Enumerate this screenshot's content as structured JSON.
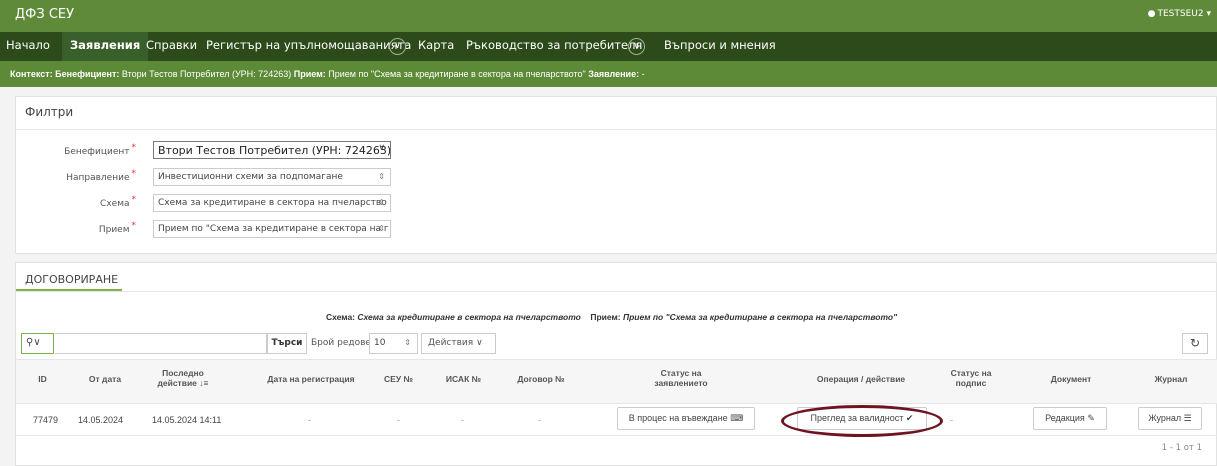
{
  "app": {
    "title": "ДФЗ СЕУ",
    "user": "TESTSEU2"
  },
  "nav": {
    "items": [
      "Начало",
      "Заявления",
      "Справки",
      "Регистър на упълномощаванията",
      "Карта",
      "Ръководство за потребителя",
      "Въпроси и мнения"
    ]
  },
  "context": {
    "l1": "Контекст:",
    "l2": "Бенефициент:",
    "v2": "Втори Тестов Потребител (УРН: 724263)",
    "l3": "Прием:",
    "v3": "Прием по \"Схема за кредитиране в сектора на пчеларството\"",
    "l4": "Заявление:",
    "v4": "-"
  },
  "filters": {
    "title": "Филтри",
    "beneficiary_label": "Бенефициент",
    "beneficiary_value": "Втори Тестов Потребител (УРН: 724263)",
    "direction_label": "Направление",
    "direction_value": "Инвестиционни схеми за подпомагане",
    "scheme_label": "Схема",
    "scheme_value": "Схема за кредитиране в сектора на пчеларство",
    "intake_label": "Прием",
    "intake_value": "Прием по \"Схема за кредитиране в сектора на г"
  },
  "section": {
    "tab": "ДОГОВОРИРАНЕ",
    "schema_label": "Схема:",
    "schema_value": "Схема за кредитиране в сектора на пчеларството",
    "intake_label": "Прием:",
    "intake_value": "Прием по \"Схема за кредитиране в сектора на пчеларството\""
  },
  "toolbar": {
    "search_button": "Търси",
    "rows_label": "Брой редове",
    "rows_value": "10",
    "actions": "Действия"
  },
  "table": {
    "headers": {
      "id": "ID",
      "from_date": "От дата",
      "last_action_1": "Последно",
      "last_action_2": "действие",
      "reg_date": "Дата на регистрация",
      "seu_no": "СЕУ №",
      "isak_no": "ИСАК №",
      "contract_no": "Договор №",
      "status_1": "Статус на",
      "status_2": "заявлението",
      "operation": "Операция / действие",
      "sign_1": "Статус на",
      "sign_2": "подпис",
      "document": "Документ",
      "journal": "Журнал"
    },
    "rows": [
      {
        "id": "77479",
        "from_date": "14.05.2024",
        "last_action": "14.05.2024 14:11",
        "reg_date": "-",
        "seu_no": "-",
        "isak_no": "-",
        "contract_no": "-",
        "status": "В процес на въвеждане",
        "operation": "Преглед за валидност",
        "sign_status": "-",
        "document": "Редакция",
        "journal": "Журнал"
      }
    ],
    "pager": "1 - 1 от 1"
  }
}
